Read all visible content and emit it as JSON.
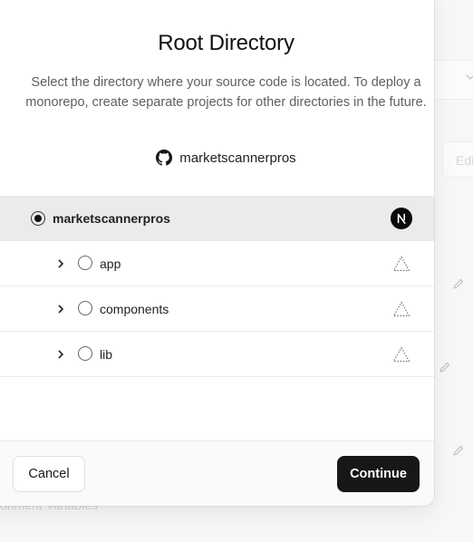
{
  "background": {
    "field_text": "Edi",
    "footer_text": "onment Variables"
  },
  "modal": {
    "title": "Root Directory",
    "description": "Select the directory where your source code is located. To deploy a monorepo, create separate projects for other directories in the future.",
    "repository": {
      "icon": "github-icon",
      "name": "marketscannerpros"
    },
    "directories": [
      {
        "name": "marketscannerpros",
        "selected": true,
        "framework_icon": "nextjs-icon"
      },
      {
        "name": "app",
        "selected": false,
        "icon": "chevron-right-icon",
        "framework_icon": "dashed-triangle-icon"
      },
      {
        "name": "components",
        "selected": false,
        "icon": "chevron-right-icon",
        "framework_icon": "dashed-triangle-icon"
      },
      {
        "name": "lib",
        "selected": false,
        "icon": "chevron-right-icon",
        "framework_icon": "dashed-triangle-icon"
      }
    ],
    "cancel_label": "Cancel",
    "continue_label": "Continue"
  },
  "colors": {
    "selected_row_bg": "#ebebeb",
    "primary_button": "#171717"
  }
}
